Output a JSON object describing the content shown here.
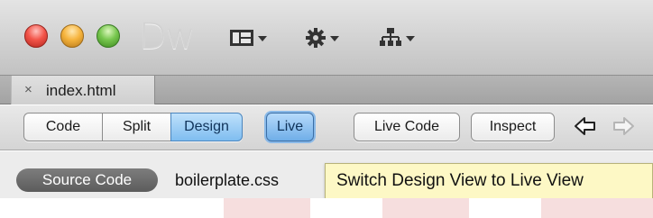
{
  "window": {
    "app_logo": "Dw",
    "traffic_lights": [
      "close",
      "minimize",
      "zoom"
    ],
    "toolbar_icons": [
      "layout-menu-icon",
      "gear-menu-icon",
      "site-menu-icon"
    ]
  },
  "document_tabs": [
    {
      "close_glyph": "×",
      "label": "index.html"
    }
  ],
  "doc_toolbar": {
    "view_buttons": [
      "Code",
      "Split",
      "Design"
    ],
    "active_view": "Design",
    "live_label": "Live",
    "live_code_label": "Live Code",
    "inspect_label": "Inspect",
    "nav_icons": [
      "back-arrow-icon",
      "forward-arrow-icon"
    ]
  },
  "related_files": {
    "source_code_label": "Source Code",
    "file_label": "boilerplate.css"
  },
  "tooltip": {
    "text": "Switch Design View to Live View"
  },
  "colors": {
    "active_button": "#7fbdf0",
    "tooltip_bg": "#fdf8c5",
    "pill_bg": "#6b6b6b"
  }
}
